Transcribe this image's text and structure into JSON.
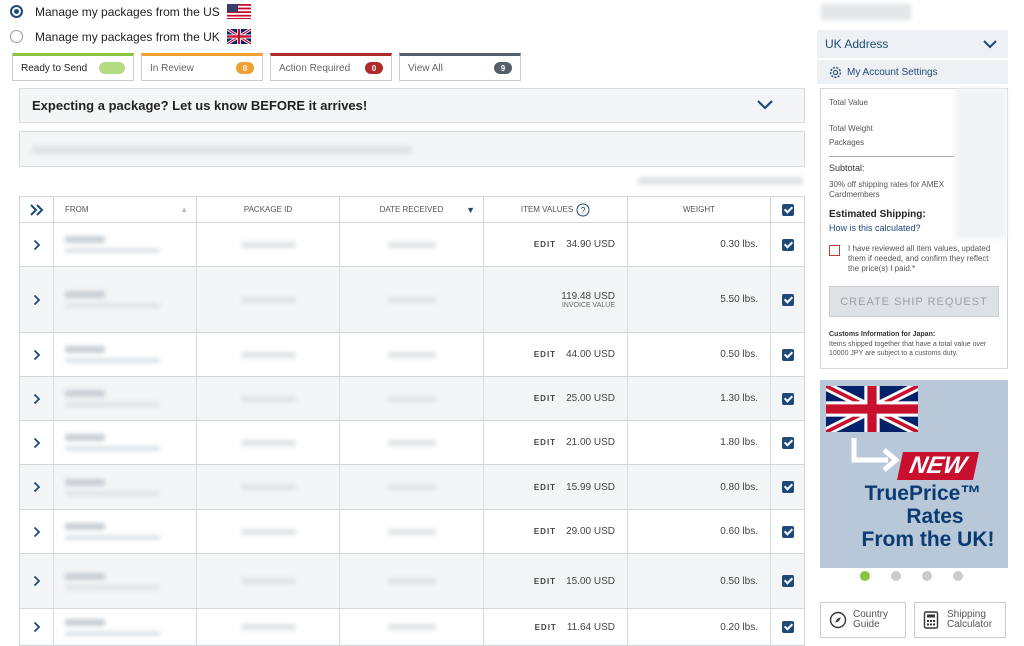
{
  "manage": {
    "us_label": "Manage my packages from the US",
    "uk_label": "Manage my packages from the UK"
  },
  "tabs": [
    {
      "label": "Ready to Send",
      "badge": "",
      "color": "#8ac53f"
    },
    {
      "label": "In Review",
      "badge": "0",
      "color": "#f0a030"
    },
    {
      "label": "Action Required",
      "badge": "0",
      "color": "#b02a2a"
    },
    {
      "label": "View All",
      "badge": "9",
      "color": "#555f6b"
    }
  ],
  "expect_bar": {
    "text": "Expecting a package? Let us know BEFORE it arrives!"
  },
  "table": {
    "headers": {
      "from": "FROM",
      "package_id": "PACKAGE ID",
      "date_received": "DATE RECEIVED",
      "item_values": "ITEM VALUES",
      "weight": "WEIGHT"
    },
    "edit_label": "EDIT",
    "rows": [
      {
        "value": "34.90 USD",
        "weight": "0.30 lbs."
      },
      {
        "value": "119.48 USD",
        "sub": "INVOICE VALUE",
        "weight": "5.50 lbs."
      },
      {
        "value": "44.00 USD",
        "weight": "0.50 lbs."
      },
      {
        "value": "25.00 USD",
        "weight": "1.30 lbs."
      },
      {
        "value": "21.00 USD",
        "weight": "1.80 lbs."
      },
      {
        "value": "15.99 USD",
        "weight": "0.80 lbs."
      },
      {
        "value": "29.00 USD",
        "weight": "0.60 lbs."
      },
      {
        "value": "15.00 USD",
        "weight": "0.50 lbs."
      },
      {
        "value": "11.64 USD",
        "weight": "0.20 lbs."
      }
    ]
  },
  "sidebar": {
    "uk_address": "UK Address",
    "account_settings": "My Account Settings",
    "total_value": "Total Value",
    "total_weight": "Total Weight",
    "packages": "Packages",
    "subtotal": "Subtotal:",
    "amex_note": "30% off shipping rates for AMEX Cardmembers",
    "est_shipping": "Estimated Shipping:",
    "how_calc": "How is this calculated?",
    "review_text": "I have reviewed all item values, updated them if needed, and confirm they reflect the price(s) I paid.*",
    "ship_button": "CREATE SHIP REQUEST",
    "customs_title": "Customs Information for Japan:",
    "customs_text": "Items shipped together that have a total value over 10000 JPY are subject to a customs duty."
  },
  "banner": {
    "new": "NEW",
    "line1": "TruePrice™",
    "line2": "Rates",
    "line3": "From the UK!"
  },
  "tools": {
    "country_guide": [
      "Country",
      "Guide"
    ],
    "shipping_calc": [
      "Shipping",
      "Calculator"
    ]
  },
  "colors": {
    "brand": "#1e4a7a",
    "green": "#8ac53f"
  }
}
